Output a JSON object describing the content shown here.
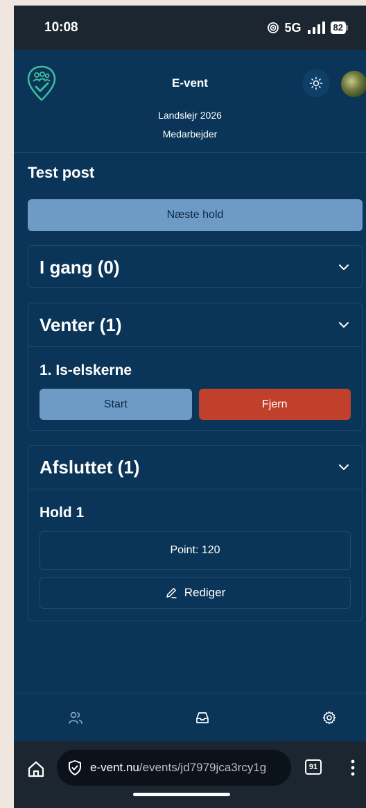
{
  "status_bar": {
    "time": "10:08",
    "network": "5G",
    "battery": "82"
  },
  "header": {
    "app_title": "E-vent",
    "event_name": "Landslejr 2026",
    "role": "Medarbejder"
  },
  "main": {
    "post_title": "Test post",
    "next_button_label": "Næste hold",
    "sections": {
      "in_progress": {
        "title": "I gang (0)"
      },
      "waiting": {
        "title": "Venter (1)",
        "team": "1. Is-elskerne",
        "start_label": "Start",
        "remove_label": "Fjern"
      },
      "done": {
        "title": "Afsluttet (1)",
        "team": "Hold 1",
        "points": "Point: 120",
        "edit_label": "Rediger"
      }
    }
  },
  "browser": {
    "url_domain": "e-vent.nu",
    "url_path": "/events/jd7979jca3rcy1g",
    "tab_count": "91"
  },
  "colors": {
    "background": "#0b3558",
    "primary_button": "#6e9ac6",
    "danger_button": "#c0402c",
    "accent": "#3fbf9f"
  }
}
